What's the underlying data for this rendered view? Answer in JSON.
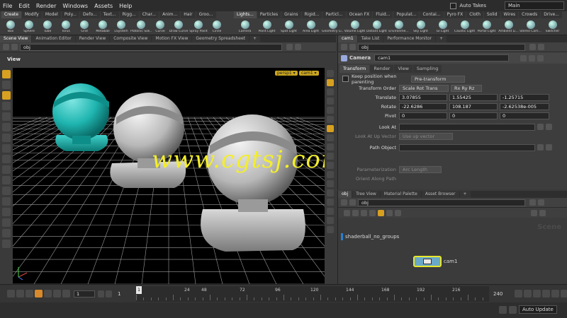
{
  "menu": {
    "items": [
      "File",
      "Edit",
      "Render",
      "Windows",
      "Assets",
      "Help"
    ],
    "auto_takes": "Auto Takes",
    "desktop": "Main"
  },
  "shelf_left": {
    "tabs": [
      "Create",
      "Modify",
      "Model",
      "Poly...",
      "Defo...",
      "Text...",
      "Rigg...",
      "Char...",
      "Anim...",
      "Hair",
      "Groo..."
    ],
    "tools": [
      "Box",
      "Sphere",
      "Tube",
      "Torus",
      "Grid",
      "Metaball",
      "LSystem",
      "Platonic Soli...",
      "Curve",
      "Draw Curve",
      "Spray Paint",
      "Circle"
    ]
  },
  "shelf_right": {
    "tabs": [
      "Lights...",
      "Particles",
      "Grains",
      "Rigid...",
      "Particl...",
      "Ocean FX",
      "Fluid...",
      "Populat...",
      "Contai...",
      "Pyro FX",
      "Cloth",
      "Solid",
      "Wires",
      "Crowds",
      "Drive..."
    ],
    "tools": [
      "Camera",
      "Point Light",
      "Spot Light",
      "Area Light",
      "Geometry Li...",
      "Volume Light",
      "Distant Light",
      "Environme...",
      "Sky Light",
      "GI Light",
      "Caustic Light",
      "Portal Light",
      "Ambient Li...",
      "Stereo Cam...",
      "Switcher"
    ]
  },
  "left_pane": {
    "tabs": [
      "Scene View",
      "Animation Editor",
      "Render View",
      "Composite View",
      "Motion FX View",
      "Geometry Spreadsheet"
    ],
    "path": "obj",
    "view_title": "View",
    "persp_menu": "persp1 ▾",
    "cam_menu": "cam1 ▾",
    "watermark": "www.cgtsj.com"
  },
  "param_pane": {
    "tabs": [
      "cam1",
      "Take List",
      "Performance Monitor"
    ],
    "path": "obj",
    "node_type": "Camera",
    "node_name": "cam1",
    "sub_tabs": [
      "Transform",
      "Render",
      "View",
      "Sampling"
    ],
    "keep_position_label": "Keep position when parenting",
    "keep_position_value": "Pre-transform",
    "transform_order_label": "Transform Order",
    "transform_order_value": "Scale Rot Trans",
    "rotate_order_value": "Rx Ry Rz",
    "translate_label": "Translate",
    "translate": [
      "3.07855",
      "1.55425",
      "-1.25715"
    ],
    "rotate_label": "Rotate",
    "rotate": [
      "-22.6286",
      "108.187",
      "-2.62538e-005"
    ],
    "pivot_label": "Pivot",
    "pivot": [
      "0",
      "0",
      "0"
    ],
    "look_at_label": "Look At",
    "look_at_up_label": "Look At Up Vector",
    "look_at_up_value": "Use up vector",
    "path_object_label": "Path Object",
    "parameterization_label": "Parameterization",
    "parameterization_value": "Arc Length",
    "orient_label": "Orient Along Path"
  },
  "network_pane": {
    "tabs": [
      "obj",
      "Tree View",
      "Material Palette",
      "Asset Browser"
    ],
    "path": "obj",
    "watermark": "Scene",
    "node_shaderball": "shaderball_no_groups",
    "node_cam": "cam1"
  },
  "timeline": {
    "current_frame": "1",
    "start_frame": "1",
    "start_field": "1",
    "end_frame": "240",
    "ticks": [
      "24",
      "48",
      "72",
      "96",
      "120",
      "144",
      "168",
      "192",
      "216"
    ]
  },
  "status": {
    "auto_update": "Auto Update"
  },
  "colors": {
    "teal_object": "#1fb5b0",
    "gray_object": "#b8b8b8",
    "watermark": "#f3ee2a",
    "accent_orange": "#d88a2a"
  }
}
